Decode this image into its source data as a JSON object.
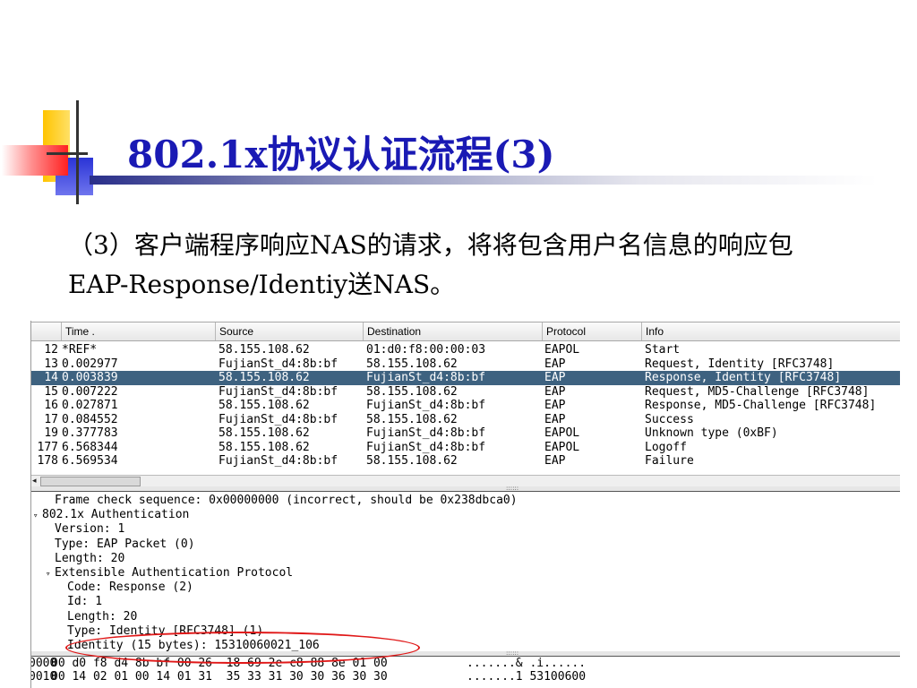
{
  "slide": {
    "title": "802.1x协议认证流程(3)",
    "body": "（3）客户端程序响应NAS的请求，将将包含用户名信息的响应包EAP-Response/Identiy送NAS。"
  },
  "packet_list": {
    "columns": [
      "Time .",
      "Source",
      "Destination",
      "Protocol",
      "Info"
    ],
    "rows": [
      {
        "no": "12",
        "time": "*REF*",
        "source": "58.155.108.62",
        "destination": "01:d0:f8:00:00:03",
        "protocol": "EAPOL",
        "info": "Start",
        "selected": false
      },
      {
        "no": "13",
        "time": "0.002977",
        "source": "FujianSt_d4:8b:bf",
        "destination": "58.155.108.62",
        "protocol": "EAP",
        "info": "Request, Identity [RFC3748]",
        "selected": false
      },
      {
        "no": "14",
        "time": "0.003839",
        "source": "58.155.108.62",
        "destination": "FujianSt_d4:8b:bf",
        "protocol": "EAP",
        "info": "Response, Identity [RFC3748]",
        "selected": true
      },
      {
        "no": "15",
        "time": "0.007222",
        "source": "FujianSt_d4:8b:bf",
        "destination": "58.155.108.62",
        "protocol": "EAP",
        "info": "Request, MD5-Challenge [RFC3748]",
        "selected": false
      },
      {
        "no": "16",
        "time": "0.027871",
        "source": "58.155.108.62",
        "destination": "FujianSt_d4:8b:bf",
        "protocol": "EAP",
        "info": "Response, MD5-Challenge [RFC3748]",
        "selected": false
      },
      {
        "no": "17",
        "time": "0.084552",
        "source": "FujianSt_d4:8b:bf",
        "destination": "58.155.108.62",
        "protocol": "EAP",
        "info": "Success",
        "selected": false
      },
      {
        "no": "19",
        "time": "0.377783",
        "source": "58.155.108.62",
        "destination": "FujianSt_d4:8b:bf",
        "protocol": "EAPOL",
        "info": "Unknown type (0xBF)",
        "selected": false
      },
      {
        "no": "177",
        "time": "6.568344",
        "source": "58.155.108.62",
        "destination": "FujianSt_d4:8b:bf",
        "protocol": "EAPOL",
        "info": "Logoff",
        "selected": false
      },
      {
        "no": "178",
        "time": "6.569534",
        "source": "FujianSt_d4:8b:bf",
        "destination": "58.155.108.62",
        "protocol": "EAP",
        "info": "Failure",
        "selected": false
      }
    ]
  },
  "details": [
    {
      "text": "Frame check sequence: 0x00000000 (incorrect, should be 0x238dbca0)",
      "expander": ""
    },
    {
      "text": "802.1x Authentication",
      "expander": "▿"
    },
    {
      "text": "Version: 1",
      "expander": ""
    },
    {
      "text": "Type: EAP Packet (0)",
      "expander": ""
    },
    {
      "text": "Length: 20",
      "expander": ""
    },
    {
      "text": "Extensible Authentication Protocol",
      "expander": "▿"
    },
    {
      "text": "Code: Response (2)",
      "expander": ""
    },
    {
      "text": "Id: 1",
      "expander": ""
    },
    {
      "text": "Length: 20",
      "expander": ""
    },
    {
      "text": "Type: Identity [RFC3748] (1)",
      "expander": ""
    },
    {
      "text": "Identity (15 bytes): 15310060021_106",
      "expander": ""
    }
  ],
  "hex": [
    {
      "offset": "0000",
      "bytes": "00 d0 f8 d4 8b bf 00 26  18 69 2e c8 88 8e 01 00",
      "ascii": ".......& .i......"
    },
    {
      "offset": "0010",
      "bytes": "00 14 02 01 00 14 01 31  35 33 31 30 30 36 30 30",
      "ascii": ".......1 53100600"
    }
  ],
  "colors": {
    "title": "#1a1ab4",
    "selected_row": "#3e6280",
    "highlight_ellipse": "#e01818"
  }
}
